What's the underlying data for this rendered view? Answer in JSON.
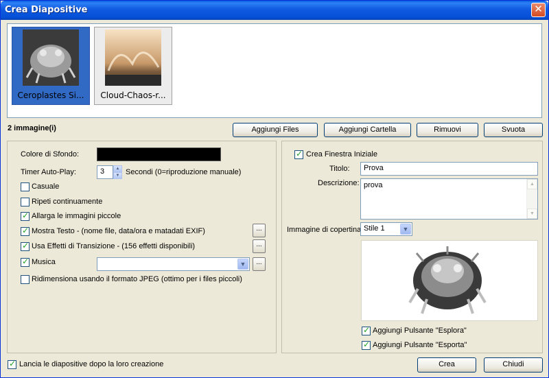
{
  "window": {
    "title": "Crea Diapositive"
  },
  "thumbnails": [
    {
      "label": "Ceroplastes Si...",
      "selected": true
    },
    {
      "label": "Cloud-Chaos-r...",
      "selected": false
    }
  ],
  "image_count": "2 immagine(i)",
  "toolbar": {
    "add_files": "Aggiungi Files",
    "add_folder": "Aggiungi Cartella",
    "remove": "Rimuovi",
    "clear": "Svuota"
  },
  "left": {
    "bg_color_label": "Colore di Sfondo:",
    "bg_color": "#000000",
    "timer_label": "Timer Auto-Play:",
    "timer_value": "3",
    "timer_hint": "Secondi (0=riproduzione manuale)",
    "random": {
      "label": "Casuale",
      "checked": false
    },
    "repeat": {
      "label": "Ripeti continuamente",
      "checked": false
    },
    "enlarge": {
      "label": "Allarga le immagini piccole",
      "checked": true
    },
    "show_text": {
      "label": "Mostra Testo - (nome file, data/ora e matadati EXIF)",
      "checked": true
    },
    "transitions": {
      "label": "Usa Effetti di Transizione - (156 effetti disponibili)",
      "checked": true
    },
    "music": {
      "label": "Musica",
      "checked": true,
      "value": ""
    },
    "resize_jpeg": {
      "label": "Ridimensiona usando il formato JPEG (ottimo per i files piccoli)",
      "checked": false
    },
    "dots": "..."
  },
  "right": {
    "intro": {
      "label": "Crea Finestra Iniziale",
      "checked": true
    },
    "title_label": "Titolo:",
    "title_value": "Prova",
    "desc_label": "Descrizione:",
    "desc_value": "prova",
    "cover_label": "Immagine di copertina:",
    "cover_style": "Stile 1",
    "explore": {
      "label": "Aggiungi Pulsante \"Esplora\"",
      "checked": true
    },
    "export": {
      "label": "Aggiungi Pulsante \"Esporta\"",
      "checked": true
    }
  },
  "footer": {
    "launch": {
      "label": "Lancia le diapositive dopo la loro creazione",
      "checked": true
    },
    "create": "Crea",
    "close": "Chiudi"
  },
  "icons": {
    "close": "close-icon",
    "combo": "chevron-down-icon",
    "spin_up": "arrow-up-icon",
    "spin_down": "arrow-down-icon"
  }
}
